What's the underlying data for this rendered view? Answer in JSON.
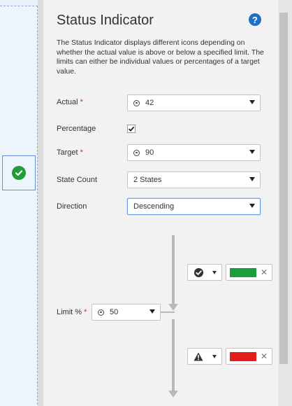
{
  "panel": {
    "title": "Status Indicator",
    "help_icon": "question-circle-icon",
    "description": "The Status Indicator displays different icons depending on whether the actual value is above or below a specified limit. The limits can either be individual values or percentages of a target value."
  },
  "fields": {
    "actual": {
      "label": "Actual",
      "required": "*",
      "value": "42"
    },
    "percentage": {
      "label": "Percentage",
      "checked": true
    },
    "target": {
      "label": "Target",
      "required": "*",
      "value": "90"
    },
    "state_count": {
      "label": "State Count",
      "value": "2 States"
    },
    "direction": {
      "label": "Direction",
      "value": "Descending"
    }
  },
  "limits": {
    "limit_label": "Limit %",
    "limit_required": "*",
    "limit_value": "50",
    "states": [
      {
        "icon": "check-circle-icon",
        "color": "#1f9d3a",
        "remove": "✕"
      },
      {
        "icon": "warning-triangle-icon",
        "color": "#e31b1b",
        "remove": "✕"
      }
    ]
  },
  "colors": {
    "accent": "#1f6fc4",
    "success": "#1f9d3a",
    "danger": "#e31b1b"
  }
}
